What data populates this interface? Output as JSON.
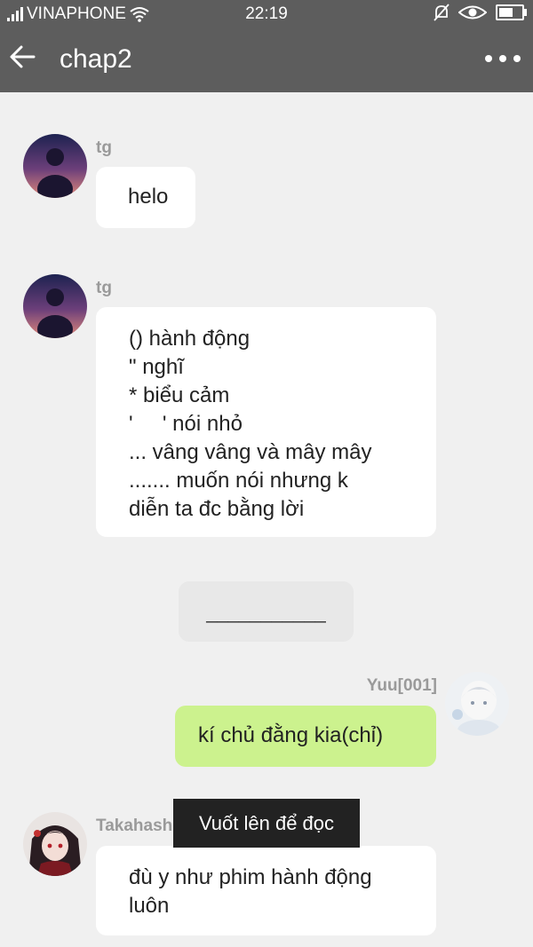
{
  "status_bar": {
    "carrier": "VINAPHONE",
    "time": "22:19",
    "icons": [
      "signal-icon",
      "wifi-icon",
      "mute-icon",
      "eye-icon",
      "battery-icon"
    ]
  },
  "header": {
    "title": "chap2",
    "back_icon": "back-arrow-icon",
    "more_icon": "more-dots-icon"
  },
  "messages": [
    {
      "sender": "tg",
      "side": "left",
      "lines": [
        "helo"
      ]
    },
    {
      "sender": "tg",
      "side": "left",
      "lines": [
        "() hành động",
        "\" nghĩ",
        "* biểu cảm",
        "'     ' nói nhỏ",
        "... vâng vâng và mây mây",
        "....... muốn nói nhưng k",
        "diễn ta đc bằng lời"
      ]
    },
    {
      "type": "separator",
      "text": "___________"
    },
    {
      "sender": "Yuu[001]",
      "side": "right",
      "lines": [
        "kí chủ đằng kia(chỉ)"
      ]
    },
    {
      "sender": "Takahashi N",
      "side": "left",
      "lines": [
        "đù y như phim hành động",
        "luôn"
      ]
    }
  ],
  "toast": "Vuốt lên để đọc",
  "colors": {
    "header_bg": "#5d5d5d",
    "page_bg": "#f0f0f0",
    "my_bubble": "#ccf28e",
    "other_bubble": "#ffffff"
  }
}
